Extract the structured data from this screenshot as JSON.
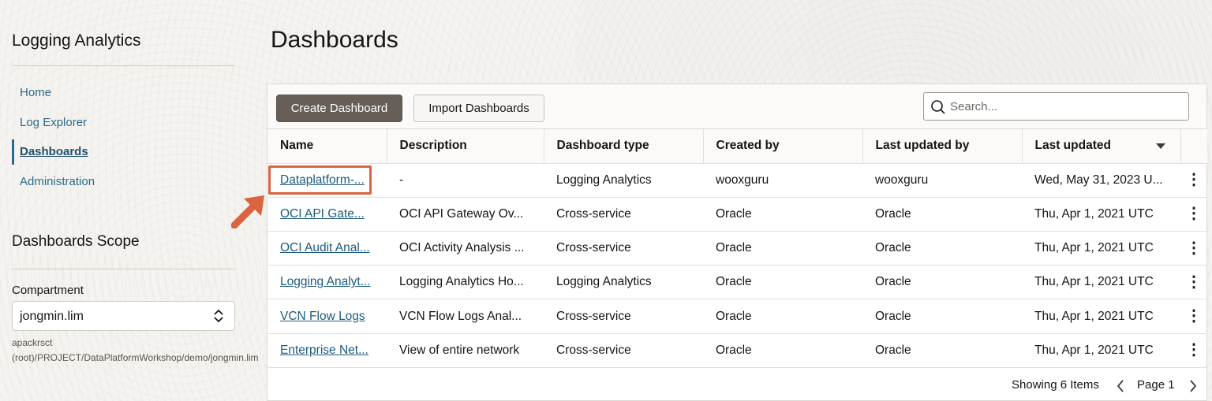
{
  "sidebar": {
    "app_title": "Logging Analytics",
    "nav": [
      {
        "label": "Home"
      },
      {
        "label": "Log Explorer"
      },
      {
        "label": "Dashboards",
        "active": true
      },
      {
        "label": "Administration"
      }
    ],
    "scope_title": "Dashboards Scope",
    "compartment_label": "Compartment",
    "compartment_value": "jongmin.lim",
    "compartment_path": "apackrsct (root)/PROJECT/DataPlatformWorkshop/demo/jongmin.lim"
  },
  "main": {
    "title": "Dashboards",
    "create_button": "Create Dashboard",
    "import_button": "Import Dashboards",
    "search_placeholder": "Search...",
    "columns": [
      "Name",
      "Description",
      "Dashboard type",
      "Created by",
      "Last updated by",
      "Last updated"
    ],
    "rows": [
      {
        "name": "Dataplatform-...",
        "description": "-",
        "type": "Logging Analytics",
        "created_by": "wooxguru",
        "updated_by": "wooxguru",
        "updated": "Wed, May 31, 2023 U..."
      },
      {
        "name": "OCI API Gate...",
        "description": "OCI API Gateway Ov...",
        "type": "Cross-service",
        "created_by": "Oracle",
        "updated_by": "Oracle",
        "updated": "Thu, Apr 1, 2021 UTC"
      },
      {
        "name": "OCI Audit Anal...",
        "description": "OCI Activity Analysis ...",
        "type": "Cross-service",
        "created_by": "Oracle",
        "updated_by": "Oracle",
        "updated": "Thu, Apr 1, 2021 UTC"
      },
      {
        "name": "Logging Analyt...",
        "description": "Logging Analytics Ho...",
        "type": "Logging Analytics",
        "created_by": "Oracle",
        "updated_by": "Oracle",
        "updated": "Thu, Apr 1, 2021 UTC"
      },
      {
        "name": "VCN Flow Logs",
        "description": "VCN Flow Logs Anal...",
        "type": "Cross-service",
        "created_by": "Oracle",
        "updated_by": "Oracle",
        "updated": "Thu, Apr 1, 2021 UTC"
      },
      {
        "name": "Enterprise Net...",
        "description": "View of entire network",
        "type": "Cross-service",
        "created_by": "Oracle",
        "updated_by": "Oracle",
        "updated": "Thu, Apr 1, 2021 UTC"
      }
    ],
    "footer_text": "Showing 6 Items",
    "page_text": "Page 1"
  },
  "icons": {
    "search": "search-icon",
    "sort": "sort-desc-icon",
    "kebab": "more-vertical-icon",
    "prev": "chevron-left-icon",
    "next": "chevron-right-icon",
    "callout": "arrow-callout-icon"
  },
  "colors": {
    "link": "#1d5a7e",
    "primary_button": "#665e57",
    "callout": "#d9643f"
  }
}
